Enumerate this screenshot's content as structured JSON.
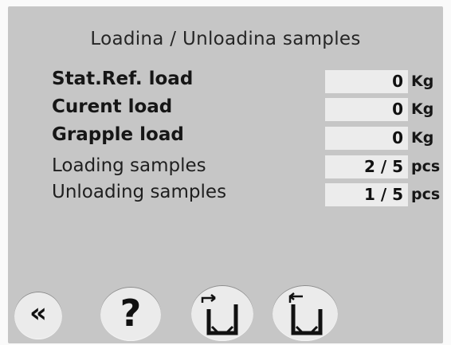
{
  "title": "Loadina / Unloadina samples",
  "rows": [
    {
      "label": "Stat.Ref. load",
      "value": "0",
      "unit": "Kg"
    },
    {
      "label": "Curent load",
      "value": "0",
      "unit": "Kg"
    },
    {
      "label": "Grapple load",
      "value": "0",
      "unit": "Kg"
    },
    {
      "label": "Loading samples",
      "value": "2 / 5",
      "unit": "pcs"
    },
    {
      "label": "Unloading samples",
      "value": "1 / 5",
      "unit": "pcs"
    }
  ],
  "buttons": {
    "back": {
      "icon": "double-chevron-left-icon",
      "glyph": "«"
    },
    "help": {
      "icon": "question-icon",
      "glyph": "?"
    },
    "load": {
      "icon": "load-sample-icon"
    },
    "unload": {
      "icon": "unload-sample-icon"
    }
  }
}
